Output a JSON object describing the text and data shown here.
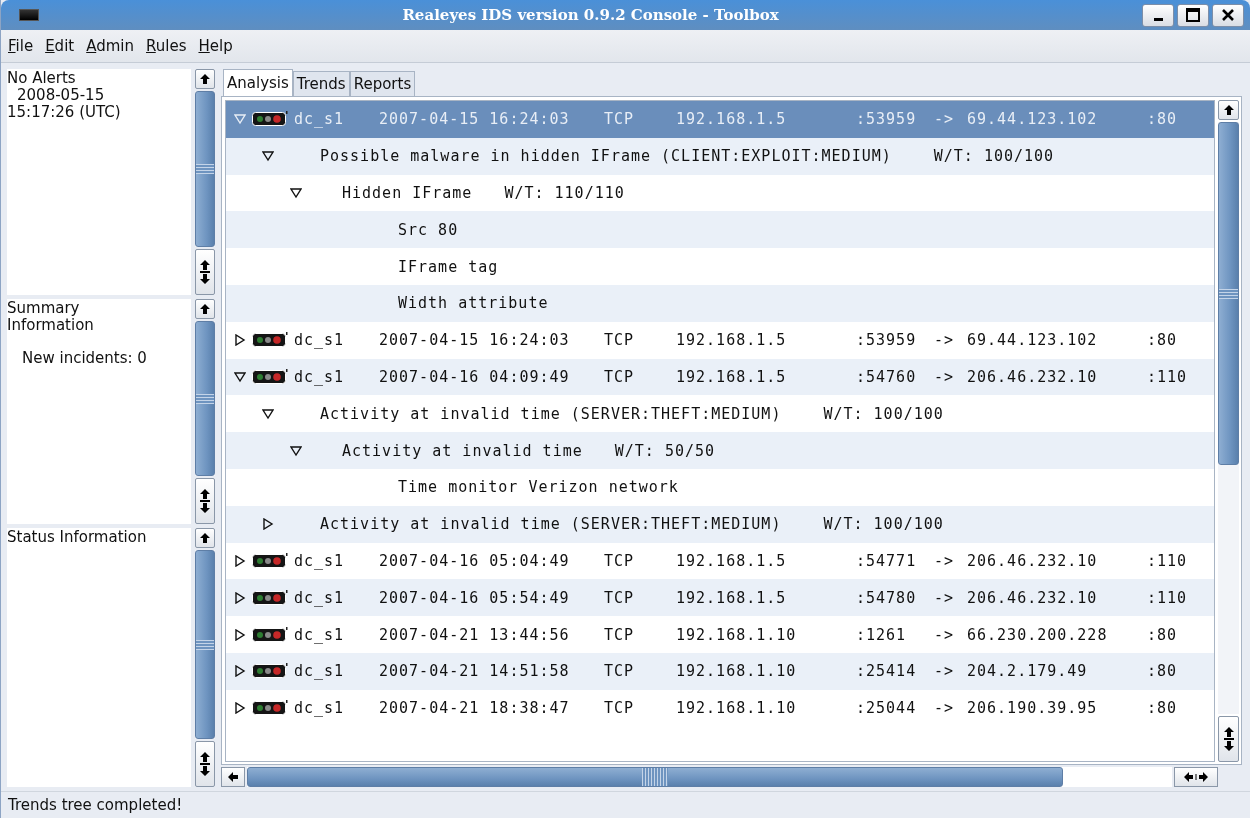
{
  "window": {
    "title": "Realeyes IDS version 0.9.2 Console - Toolbox"
  },
  "menu": [
    "File",
    "Edit",
    "Admin",
    "Rules",
    "Help"
  ],
  "left_panels": [
    {
      "lines": [
        "No Alerts",
        "2008-05-15",
        "15:17:26 (UTC)"
      ]
    },
    {
      "lines": [
        "Summary Information",
        "New incidents: 0"
      ]
    },
    {
      "lines": [
        "Status Information"
      ]
    }
  ],
  "tabs": [
    {
      "label": "Analysis",
      "selected": true
    },
    {
      "label": "Trends",
      "selected": false
    },
    {
      "label": "Reports",
      "selected": false
    }
  ],
  "tree": [
    {
      "kind": "event",
      "expanded": true,
      "selected": true,
      "sensor": "dc_s1",
      "datetime": "2007-04-15 16:24:03",
      "protocol": "TCP",
      "src_ip": "192.168.1.5",
      "src_port": ":53959",
      "arrow": "->",
      "dst_ip": "69.44.123.102",
      "dst_port": ":80",
      "children": [
        {
          "kind": "rule",
          "expanded": true,
          "selected": false,
          "text": "Possible malware in hidden IFrame (CLIENT:EXPLOIT:MEDIUM)",
          "wt": "W/T: 100/100",
          "children": [
            {
              "kind": "trigger",
              "expanded": true,
              "selected": false,
              "text": "Hidden IFrame",
              "wt": "W/T: 110/110",
              "children": [
                {
                  "kind": "detail",
                  "selected": false,
                  "text": "Src 80"
                },
                {
                  "kind": "detail",
                  "selected": false,
                  "text": "IFrame tag"
                },
                {
                  "kind": "detail",
                  "selected": false,
                  "text": "Width attribute"
                }
              ]
            }
          ]
        }
      ]
    },
    {
      "kind": "event",
      "expanded": false,
      "selected": false,
      "sensor": "dc_s1",
      "datetime": "2007-04-15 16:24:03",
      "protocol": "TCP",
      "src_ip": "192.168.1.5",
      "src_port": ":53959",
      "arrow": "->",
      "dst_ip": "69.44.123.102",
      "dst_port": ":80"
    },
    {
      "kind": "event",
      "expanded": true,
      "selected": false,
      "sensor": "dc_s1",
      "datetime": "2007-04-16 04:09:49",
      "protocol": "TCP",
      "src_ip": "192.168.1.5",
      "src_port": ":54760",
      "arrow": "->",
      "dst_ip": "206.46.232.10",
      "dst_port": ":110",
      "children": [
        {
          "kind": "rule",
          "expanded": true,
          "selected": false,
          "text": "Activity at invalid time (SERVER:THEFT:MEDIUM)",
          "wt": "W/T: 100/100",
          "children": [
            {
              "kind": "trigger",
              "expanded": true,
              "selected": false,
              "text": "Activity at invalid time",
              "wt": "W/T: 50/50",
              "children": [
                {
                  "kind": "detail",
                  "selected": false,
                  "text": "Time monitor Verizon network"
                }
              ]
            }
          ]
        },
        {
          "kind": "rule",
          "expanded": false,
          "selected": false,
          "text": "Activity at invalid time (SERVER:THEFT:MEDIUM)",
          "wt": "W/T: 100/100"
        }
      ]
    },
    {
      "kind": "event",
      "expanded": false,
      "selected": false,
      "sensor": "dc_s1",
      "datetime": "2007-04-16 05:04:49",
      "protocol": "TCP",
      "src_ip": "192.168.1.5",
      "src_port": ":54771",
      "arrow": "->",
      "dst_ip": "206.46.232.10",
      "dst_port": ":110"
    },
    {
      "kind": "event",
      "expanded": false,
      "selected": false,
      "sensor": "dc_s1",
      "datetime": "2007-04-16 05:54:49",
      "protocol": "TCP",
      "src_ip": "192.168.1.5",
      "src_port": ":54780",
      "arrow": "->",
      "dst_ip": "206.46.232.10",
      "dst_port": ":110"
    },
    {
      "kind": "event",
      "expanded": false,
      "selected": false,
      "sensor": "dc_s1",
      "datetime": "2007-04-21 13:44:56",
      "protocol": "TCP",
      "src_ip": "192.168.1.10",
      "src_port": ":1261",
      "arrow": "->",
      "dst_ip": "66.230.200.228",
      "dst_port": ":80"
    },
    {
      "kind": "event",
      "expanded": false,
      "selected": false,
      "sensor": "dc_s1",
      "datetime": "2007-04-21 14:51:58",
      "protocol": "TCP",
      "src_ip": "192.168.1.10",
      "src_port": ":25414",
      "arrow": "->",
      "dst_ip": "204.2.179.49",
      "dst_port": ":80"
    },
    {
      "kind": "event",
      "expanded": false,
      "selected": false,
      "sensor": "dc_s1",
      "datetime": "2007-04-21 18:38:47",
      "protocol": "TCP",
      "src_ip": "192.168.1.10",
      "src_port": ":25044",
      "arrow": "->",
      "dst_ip": "206.190.39.95",
      "dst_port": ":80"
    }
  ],
  "status_bar": "Trends tree completed!"
}
